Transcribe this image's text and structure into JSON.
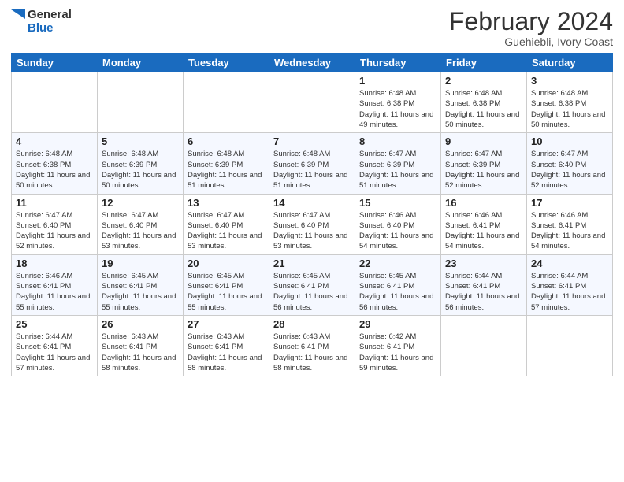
{
  "logo": {
    "line1": "General",
    "line2": "Blue"
  },
  "title": "February 2024",
  "subtitle": "Guehiebli, Ivory Coast",
  "weekdays": [
    "Sunday",
    "Monday",
    "Tuesday",
    "Wednesday",
    "Thursday",
    "Friday",
    "Saturday"
  ],
  "weeks": [
    [
      {
        "day": "",
        "info": ""
      },
      {
        "day": "",
        "info": ""
      },
      {
        "day": "",
        "info": ""
      },
      {
        "day": "",
        "info": ""
      },
      {
        "day": "1",
        "info": "Sunrise: 6:48 AM\nSunset: 6:38 PM\nDaylight: 11 hours and 49 minutes."
      },
      {
        "day": "2",
        "info": "Sunrise: 6:48 AM\nSunset: 6:38 PM\nDaylight: 11 hours and 50 minutes."
      },
      {
        "day": "3",
        "info": "Sunrise: 6:48 AM\nSunset: 6:38 PM\nDaylight: 11 hours and 50 minutes."
      }
    ],
    [
      {
        "day": "4",
        "info": "Sunrise: 6:48 AM\nSunset: 6:38 PM\nDaylight: 11 hours and 50 minutes."
      },
      {
        "day": "5",
        "info": "Sunrise: 6:48 AM\nSunset: 6:39 PM\nDaylight: 11 hours and 50 minutes."
      },
      {
        "day": "6",
        "info": "Sunrise: 6:48 AM\nSunset: 6:39 PM\nDaylight: 11 hours and 51 minutes."
      },
      {
        "day": "7",
        "info": "Sunrise: 6:48 AM\nSunset: 6:39 PM\nDaylight: 11 hours and 51 minutes."
      },
      {
        "day": "8",
        "info": "Sunrise: 6:47 AM\nSunset: 6:39 PM\nDaylight: 11 hours and 51 minutes."
      },
      {
        "day": "9",
        "info": "Sunrise: 6:47 AM\nSunset: 6:39 PM\nDaylight: 11 hours and 52 minutes."
      },
      {
        "day": "10",
        "info": "Sunrise: 6:47 AM\nSunset: 6:40 PM\nDaylight: 11 hours and 52 minutes."
      }
    ],
    [
      {
        "day": "11",
        "info": "Sunrise: 6:47 AM\nSunset: 6:40 PM\nDaylight: 11 hours and 52 minutes."
      },
      {
        "day": "12",
        "info": "Sunrise: 6:47 AM\nSunset: 6:40 PM\nDaylight: 11 hours and 53 minutes."
      },
      {
        "day": "13",
        "info": "Sunrise: 6:47 AM\nSunset: 6:40 PM\nDaylight: 11 hours and 53 minutes."
      },
      {
        "day": "14",
        "info": "Sunrise: 6:47 AM\nSunset: 6:40 PM\nDaylight: 11 hours and 53 minutes."
      },
      {
        "day": "15",
        "info": "Sunrise: 6:46 AM\nSunset: 6:40 PM\nDaylight: 11 hours and 54 minutes."
      },
      {
        "day": "16",
        "info": "Sunrise: 6:46 AM\nSunset: 6:41 PM\nDaylight: 11 hours and 54 minutes."
      },
      {
        "day": "17",
        "info": "Sunrise: 6:46 AM\nSunset: 6:41 PM\nDaylight: 11 hours and 54 minutes."
      }
    ],
    [
      {
        "day": "18",
        "info": "Sunrise: 6:46 AM\nSunset: 6:41 PM\nDaylight: 11 hours and 55 minutes."
      },
      {
        "day": "19",
        "info": "Sunrise: 6:45 AM\nSunset: 6:41 PM\nDaylight: 11 hours and 55 minutes."
      },
      {
        "day": "20",
        "info": "Sunrise: 6:45 AM\nSunset: 6:41 PM\nDaylight: 11 hours and 55 minutes."
      },
      {
        "day": "21",
        "info": "Sunrise: 6:45 AM\nSunset: 6:41 PM\nDaylight: 11 hours and 56 minutes."
      },
      {
        "day": "22",
        "info": "Sunrise: 6:45 AM\nSunset: 6:41 PM\nDaylight: 11 hours and 56 minutes."
      },
      {
        "day": "23",
        "info": "Sunrise: 6:44 AM\nSunset: 6:41 PM\nDaylight: 11 hours and 56 minutes."
      },
      {
        "day": "24",
        "info": "Sunrise: 6:44 AM\nSunset: 6:41 PM\nDaylight: 11 hours and 57 minutes."
      }
    ],
    [
      {
        "day": "25",
        "info": "Sunrise: 6:44 AM\nSunset: 6:41 PM\nDaylight: 11 hours and 57 minutes."
      },
      {
        "day": "26",
        "info": "Sunrise: 6:43 AM\nSunset: 6:41 PM\nDaylight: 11 hours and 58 minutes."
      },
      {
        "day": "27",
        "info": "Sunrise: 6:43 AM\nSunset: 6:41 PM\nDaylight: 11 hours and 58 minutes."
      },
      {
        "day": "28",
        "info": "Sunrise: 6:43 AM\nSunset: 6:41 PM\nDaylight: 11 hours and 58 minutes."
      },
      {
        "day": "29",
        "info": "Sunrise: 6:42 AM\nSunset: 6:41 PM\nDaylight: 11 hours and 59 minutes."
      },
      {
        "day": "",
        "info": ""
      },
      {
        "day": "",
        "info": ""
      }
    ]
  ]
}
